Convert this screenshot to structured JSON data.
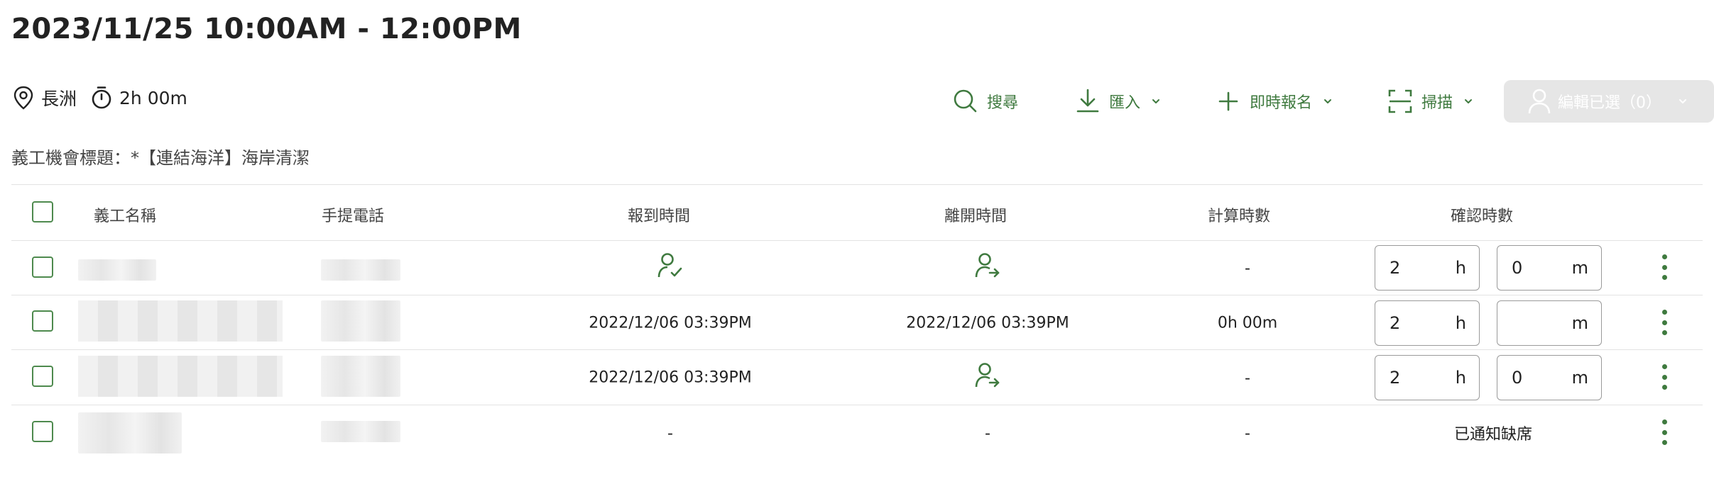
{
  "header": {
    "title": "2023/11/25 10:00AM - 12:00PM",
    "location": "長洲",
    "duration": "2h 00m",
    "subtitle": "義工機會標題：*【連結海洋】海岸清潔"
  },
  "toolbar": {
    "search_label": "搜尋",
    "import_label": "匯入",
    "instant_signup_label": "即時報名",
    "scan_label": "掃描",
    "edit_selected_label": "編輯已選（0）"
  },
  "table": {
    "columns": [
      "義工名稱",
      "手提電話",
      "報到時間",
      "離開時間",
      "計算時數",
      "確認時數"
    ],
    "rows": [
      {
        "checkin": "",
        "checkout": "",
        "calc_hours": "-",
        "confirm_h": "2",
        "confirm_m": "0",
        "status": ""
      },
      {
        "checkin": "2022/12/06 03:39PM",
        "checkout": "2022/12/06 03:39PM",
        "calc_hours": "0h 00m",
        "confirm_h": "2",
        "confirm_m": "",
        "status": ""
      },
      {
        "checkin": "2022/12/06 03:39PM",
        "checkout": "",
        "calc_hours": "-",
        "confirm_h": "2",
        "confirm_m": "0",
        "status": ""
      },
      {
        "checkin": "-",
        "checkout": "-",
        "calc_hours": "-",
        "confirm_h": "",
        "confirm_m": "",
        "status": "已通知缺席"
      }
    ],
    "unit_h": "h",
    "unit_m": "m"
  },
  "colors": {
    "accent": "#3f7a3f",
    "disabled_bg": "#e6e6e6",
    "divider": "#e3e3e3"
  },
  "icons": {
    "location": "location-pin-icon",
    "timer": "stopwatch-icon",
    "search": "search-icon",
    "import": "download-icon",
    "add": "plus-icon",
    "scan": "scan-frame-icon",
    "user": "user-icon",
    "checked_in": "user-check-icon",
    "check_out": "user-arrow-icon",
    "more": "vertical-dots-icon"
  }
}
